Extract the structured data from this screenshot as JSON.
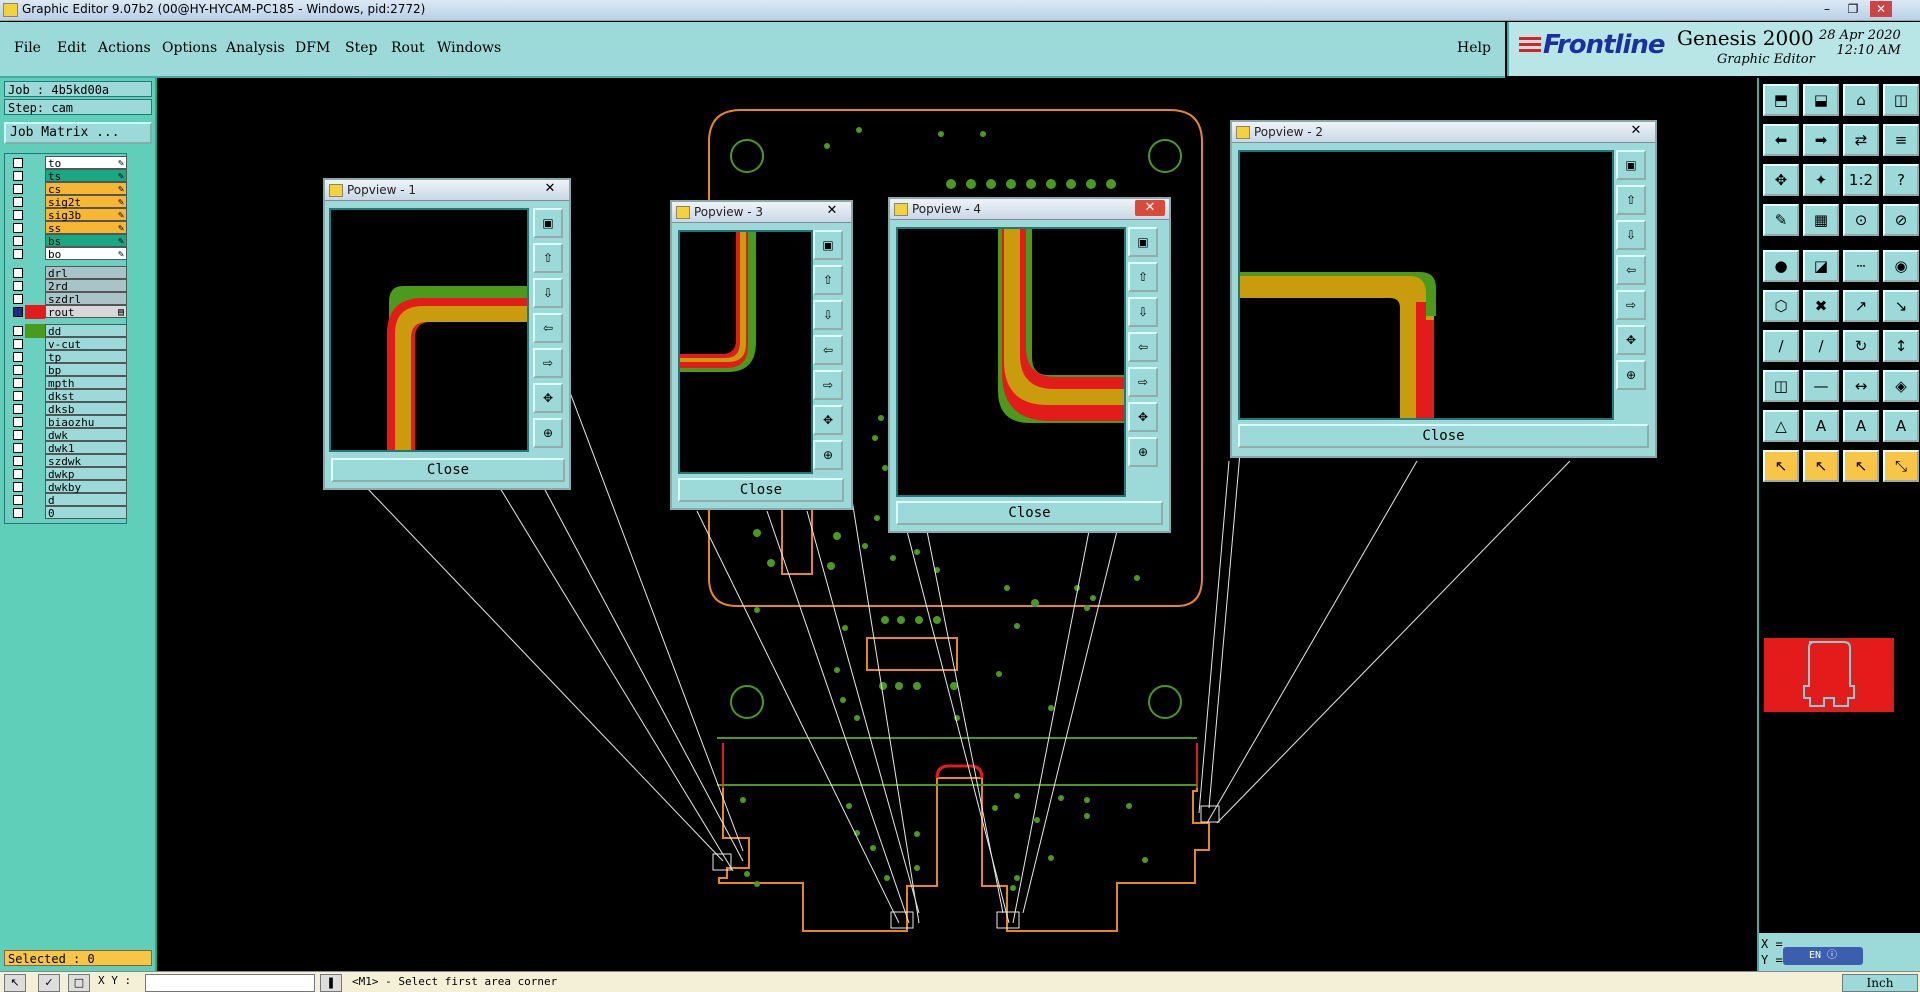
{
  "window": {
    "title": "Graphic Editor 9.07b2 (00@HY-HYCAM-PC185 - Windows, pid:2772)"
  },
  "menu": {
    "items": [
      "File",
      "Edit",
      "Actions",
      "Options",
      "Analysis",
      "DFM",
      "Step",
      "Rout",
      "Windows"
    ],
    "help": "Help"
  },
  "brand": {
    "logo": "Frontline",
    "product": "Genesis 2000",
    "subtitle": "Graphic Editor",
    "date": "28 Apr 2020",
    "time": "12:10 AM"
  },
  "job": {
    "job_label": "Job : 4b5kd00a",
    "step_label": "Step: cam",
    "matrix_button": "Job Matrix ..."
  },
  "layers": [
    {
      "name": "to",
      "color": "#ffffff",
      "edit": "✎"
    },
    {
      "name": "ts",
      "color": "#17a884",
      "edit": "✎"
    },
    {
      "name": "cs",
      "color": "#f7b733",
      "edit": "✎"
    },
    {
      "name": "sig2t",
      "color": "#f7b733",
      "edit": "✎"
    },
    {
      "name": "sig3b",
      "color": "#f7b733",
      "edit": "✎"
    },
    {
      "name": "ss",
      "color": "#f7b733",
      "edit": "✎"
    },
    {
      "name": "bs",
      "color": "#17a884",
      "edit": "✎"
    },
    {
      "name": "bo",
      "color": "#ffffff",
      "edit": "✎"
    },
    {
      "name": "drl",
      "color": "#a9c4c9",
      "edit": ""
    },
    {
      "name": "2rd",
      "color": "#a9c4c9",
      "edit": ""
    },
    {
      "name": "szdrl",
      "color": "#a9c4c9",
      "edit": ""
    },
    {
      "name": "rout",
      "color": "#d8d8d8",
      "edit": "▤"
    },
    {
      "name": "dd",
      "color": "#9cdada",
      "edit": ""
    },
    {
      "name": "v-cut",
      "color": "#9cdada",
      "edit": ""
    },
    {
      "name": "tp",
      "color": "#9cdada",
      "edit": ""
    },
    {
      "name": "bp",
      "color": "#9cdada",
      "edit": ""
    },
    {
      "name": "mpth",
      "color": "#9cdada",
      "edit": ""
    },
    {
      "name": "dkst",
      "color": "#9cdada",
      "edit": ""
    },
    {
      "name": "dksb",
      "color": "#9cdada",
      "edit": ""
    },
    {
      "name": "biaozhu",
      "color": "#9cdada",
      "edit": ""
    },
    {
      "name": "dwk",
      "color": "#9cdada",
      "edit": ""
    },
    {
      "name": "dwk1",
      "color": "#9cdada",
      "edit": ""
    },
    {
      "name": "szdwk",
      "color": "#9cdada",
      "edit": ""
    },
    {
      "name": "dwkp",
      "color": "#9cdada",
      "edit": ""
    },
    {
      "name": "dwkby",
      "color": "#9cdada",
      "edit": ""
    },
    {
      "name": "d",
      "color": "#9cdada",
      "edit": ""
    },
    {
      "name": "0",
      "color": "#9cdada",
      "edit": ""
    }
  ],
  "status": {
    "selected": "Selected : 0",
    "prompt": "<M1> - Select first area corner",
    "xy_label": "X Y :",
    "coord_x": "X =",
    "coord_y": "Y =",
    "lang": "EN",
    "units": "Inch"
  },
  "popviews": [
    {
      "title": "Popview - 1",
      "close": "Close"
    },
    {
      "title": "Popview - 2",
      "close": "Close"
    },
    {
      "title": "Popview - 3",
      "close": "Close"
    },
    {
      "title": "Popview - 4",
      "close": "Close"
    }
  ],
  "colors": {
    "board_outline": "#e8871e",
    "pad": "#4a9a1c",
    "trace": "#c89c0c",
    "highlight": "#e41b1b",
    "panel": "#9cdada"
  }
}
